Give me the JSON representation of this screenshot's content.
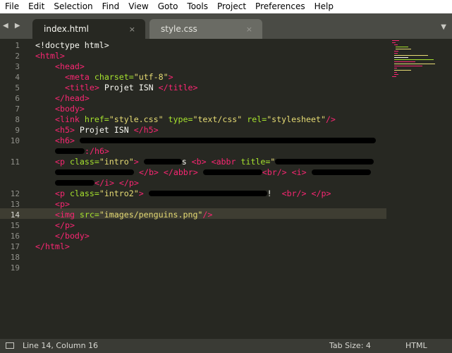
{
  "menu": [
    "File",
    "Edit",
    "Selection",
    "Find",
    "View",
    "Goto",
    "Tools",
    "Project",
    "Preferences",
    "Help"
  ],
  "tabs": [
    {
      "label": "index.html",
      "close": "×",
      "active": true
    },
    {
      "label": "style.css",
      "close": "×",
      "active": false
    }
  ],
  "nav_arrows": "◀ ▶",
  "tabs_dropdown": "▼",
  "line_numbers": [
    "1",
    "2",
    "3",
    "4",
    "5",
    "6",
    "7",
    "8",
    "9",
    "10",
    "11",
    "12",
    "13",
    "14",
    "15",
    "16",
    "17",
    "18",
    "19"
  ],
  "current_line": "14",
  "code": {
    "l1": "<!doctype html>",
    "l2": "<html>",
    "l3": "<head>",
    "l4_tag": "<meta ",
    "l4_attr": "charset=",
    "l4_val": "\"utf-8\"",
    "l4_end": ">",
    "l5_tag": "<title>",
    "l5_text": " Projet ISN ",
    "l5_end": "</title>",
    "l6": "</head>",
    "l7": "<body>",
    "l8_tag": "<link ",
    "l8_a1": "href=",
    "l8_v1": "\"style.css\"",
    "l8_a2": " type=",
    "l8_v2": "\"text/css\"",
    "l8_a3": " rel=",
    "l8_v3": "\"stylesheet\"",
    "l8_end": "/>",
    "l9_tag": "<h5>",
    "l9_text": " Projet ISN ",
    "l9_end": "</h5>",
    "l10_tag": "<h6>",
    "l10b_end": ":/h6>",
    "l11_tag": "<p ",
    "l11_attr": "class=",
    "l11_val": "\"intro\"",
    "l11_gt": ">",
    "l11_s": "s ",
    "l11_b": "<b>",
    "l11_abbr": "<abbr ",
    "l11_title": "title=",
    "l11_q": "\"",
    "l11b_close1": "</b>",
    "l11b_close2": "</abbr>",
    "l11b_br": "<br/>",
    "l11b_i": "<i>",
    "l11c_i": "</i>",
    "l11c_p": "</p>",
    "l12_tag": "<p ",
    "l12_attr": "class=",
    "l12_val": "\"intro2\"",
    "l12_gt": ">",
    "l12_bang": "!",
    "l12_br": "<br/>",
    "l12_p": "</p>",
    "l13": "<p>",
    "l14_tag": "<img ",
    "l14_attr": "src=",
    "l14_val": "\"images/penguins.png\"",
    "l14_end": "/>",
    "l15": "</p>",
    "l16": "</body>",
    "l17": "</html>"
  },
  "status": {
    "position": "Line 14, Column 16",
    "tab_size": "Tab Size: 4",
    "syntax": "HTML"
  },
  "colors": {
    "background": "#272822",
    "tag": "#f92672",
    "attribute": "#a6e22e",
    "string": "#e6db74",
    "text": "#f8f8f2"
  }
}
